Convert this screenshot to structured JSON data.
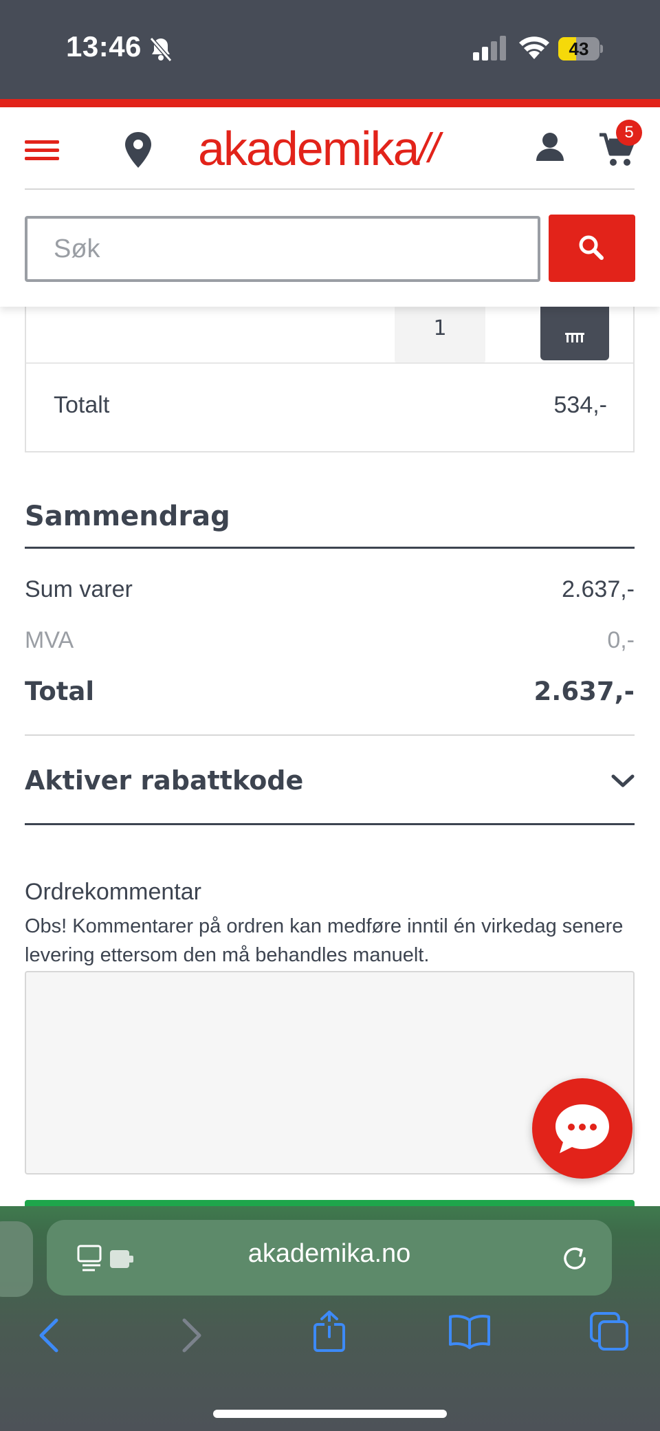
{
  "status_bar": {
    "time": "13:46",
    "battery": "43",
    "battery_level": 0.43
  },
  "header": {
    "logo_text": "akademika",
    "logo_ticks": "//",
    "cart_count": "5",
    "search": {
      "placeholder": "Søk"
    }
  },
  "cart_item": {
    "quantity": "1",
    "total_label": "Totalt",
    "total_value": "534,-"
  },
  "summary": {
    "title": "Sammendrag",
    "rows": [
      {
        "label": "Sum varer",
        "value": "2.637,-"
      },
      {
        "label": "MVA",
        "value": "0,-"
      },
      {
        "label": "Total",
        "value": "2.637,-"
      }
    ]
  },
  "discount": {
    "label": "Aktiver rabattkode"
  },
  "order_comment": {
    "title": "Ordrekommentar",
    "note": "Obs! Kommentarer på ordren kan medføre inntil én virkedag senere levering ettersom den må behandles manuelt."
  },
  "browser": {
    "url": "akademika.no"
  },
  "colors": {
    "brand_red": "#e2231a",
    "dark": "#474c57",
    "green": "#1ea64b"
  }
}
